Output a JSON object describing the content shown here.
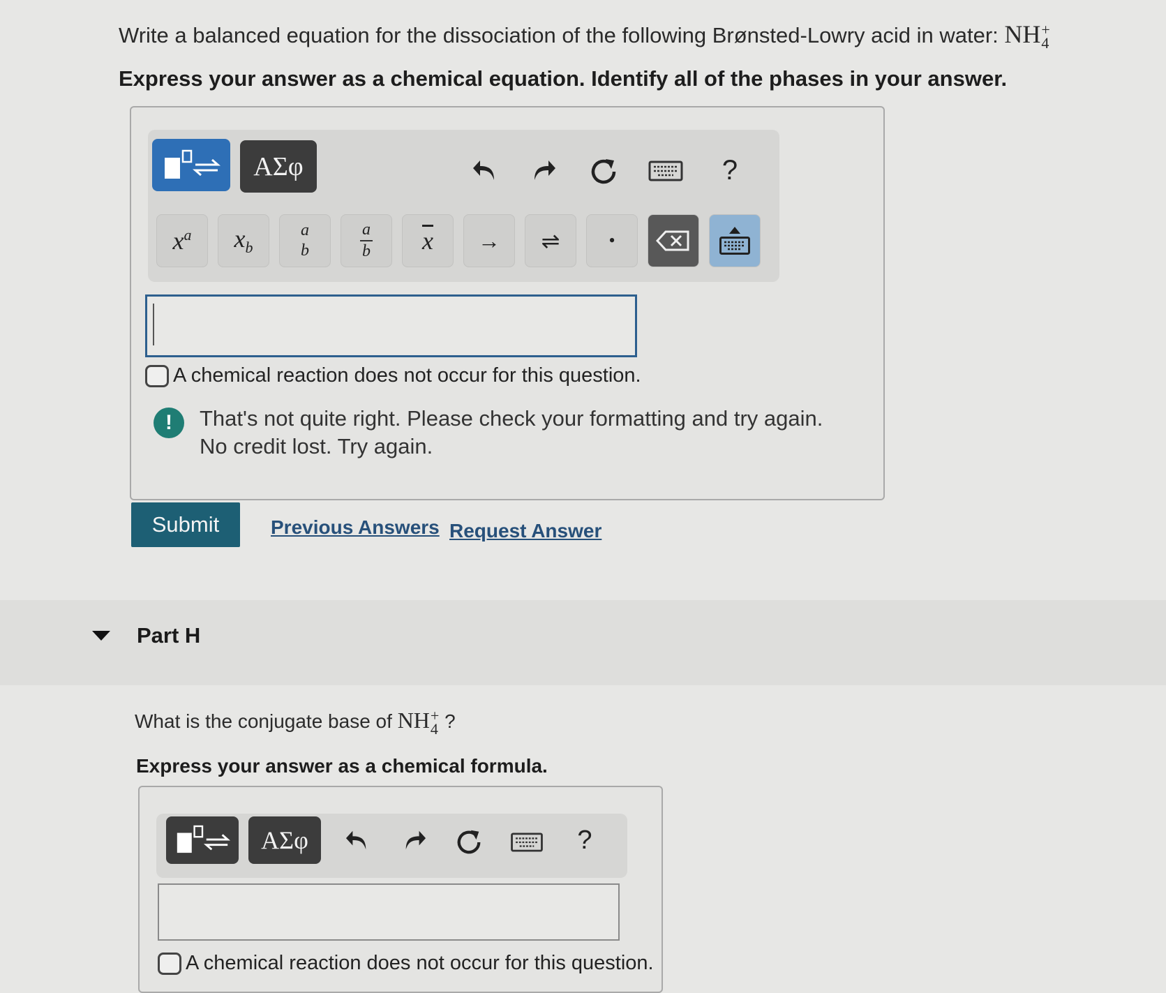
{
  "part_g": {
    "question_text": "Write a balanced equation for the dissociation of the following Brønsted-Lowry acid in water:",
    "species_base": "NH",
    "species_charge": "+",
    "species_subscript": "4",
    "instruction": "Express your answer as a chemical equation. Identify all of the phases in your answer.",
    "toolbar": {
      "greek_label": "ΑΣφ",
      "help_label": "?"
    },
    "symbols": {
      "superscript_base": "x",
      "superscript_exp": "a",
      "subscript_base": "x",
      "subscript_sub": "b",
      "stack_top": "a",
      "stack_bottom": "b",
      "fraction_top": "a",
      "fraction_bottom": "b",
      "overline": "x",
      "arrow": "→",
      "equilibrium": "⇌",
      "dot": "•"
    },
    "input_value": "",
    "no_reaction_label": "A chemical reaction does not occur for this question.",
    "feedback_icon": "!",
    "feedback_line1": "That's not quite right. Please check your formatting and try again.",
    "feedback_line2": "No credit lost. Try again.",
    "submit_label": "Submit",
    "previous_answers_label": "Previous Answers",
    "request_answer_label": "Request Answer"
  },
  "part_h": {
    "title": "Part H",
    "question_before": "What is the conjugate base of",
    "species_base": "NH",
    "species_charge": "+",
    "species_subscript": "4",
    "question_after": "?",
    "instruction": "Express your answer as a chemical formula.",
    "toolbar": {
      "greek_label": "ΑΣφ",
      "help_label": "?"
    },
    "input_value": "",
    "no_reaction_label": "A chemical reaction does not occur for this question."
  },
  "colors": {
    "accent_blue": "#2e6fb6",
    "submit_teal": "#1d5f74",
    "alert_teal": "#1f7d74",
    "link_blue": "#27507a"
  }
}
